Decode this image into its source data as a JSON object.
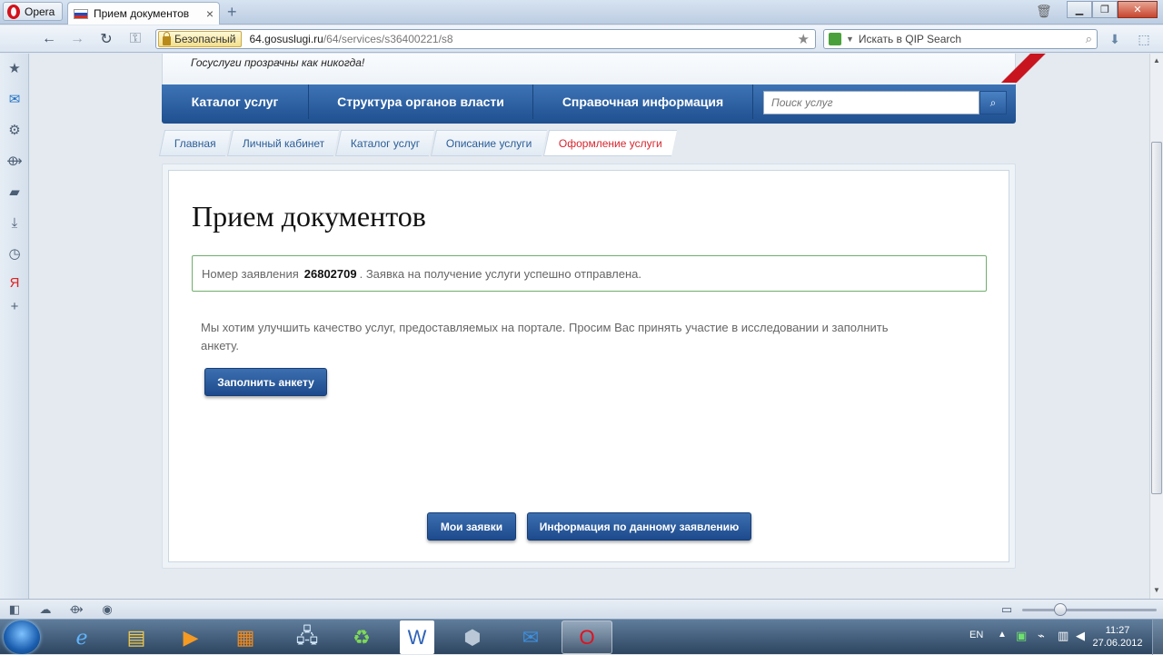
{
  "browser": {
    "menu_label": "Opera",
    "tab_title": "Прием документов",
    "security_label": "Безопасный",
    "url_host": "64.gosuslugi.ru",
    "url_path": "/64/services/s36400221/s8",
    "search_placeholder": "Искать в QIP Search"
  },
  "site": {
    "slogan": "Госуслуги прозрачны как никогда!",
    "menu": [
      "Каталог услуг",
      "Структура органов власти",
      "Справочная информация"
    ],
    "search_placeholder": "Поиск услуг",
    "breadcrumbs": [
      "Главная",
      "Личный кабинет",
      "Каталог услуг",
      "Описание услуги",
      "Оформление услуги"
    ]
  },
  "main": {
    "title": "Прием документов",
    "notice_prefix": "Номер заявления",
    "application_number": "26802709",
    "notice_suffix": ". Заявка на получение услуги успешно отправлена.",
    "survey_text": "Мы хотим улучшить качество услуг, предоставляемых на портале. Просим Вас принять участие в исследовании и заполнить анкету.",
    "survey_button": "Заполнить анкету",
    "my_requests_button": "Мои заявки",
    "info_button": "Информация по данному заявлению"
  },
  "taskbar": {
    "lang": "EN",
    "time": "11:27",
    "date": "27.06.2012"
  },
  "colors": {
    "menu_blue": "#1f4f8f",
    "active_crumb": "#d7262f",
    "success_border": "#6fae6c"
  }
}
